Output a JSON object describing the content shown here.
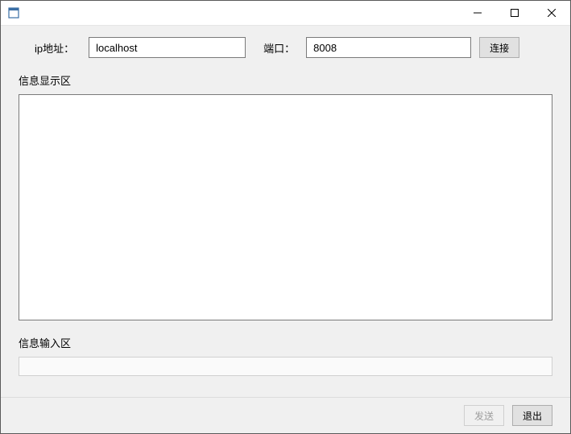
{
  "titlebar": {
    "title": ""
  },
  "connection": {
    "ip_label": "ip地址：",
    "ip_value": "localhost",
    "port_label": "端口：",
    "port_value": "8008",
    "connect_label": "连接"
  },
  "display": {
    "section_label": "信息显示区",
    "content": ""
  },
  "input": {
    "section_label": "信息输入区",
    "value": ""
  },
  "footer": {
    "send_label": "发送",
    "exit_label": "退出"
  }
}
